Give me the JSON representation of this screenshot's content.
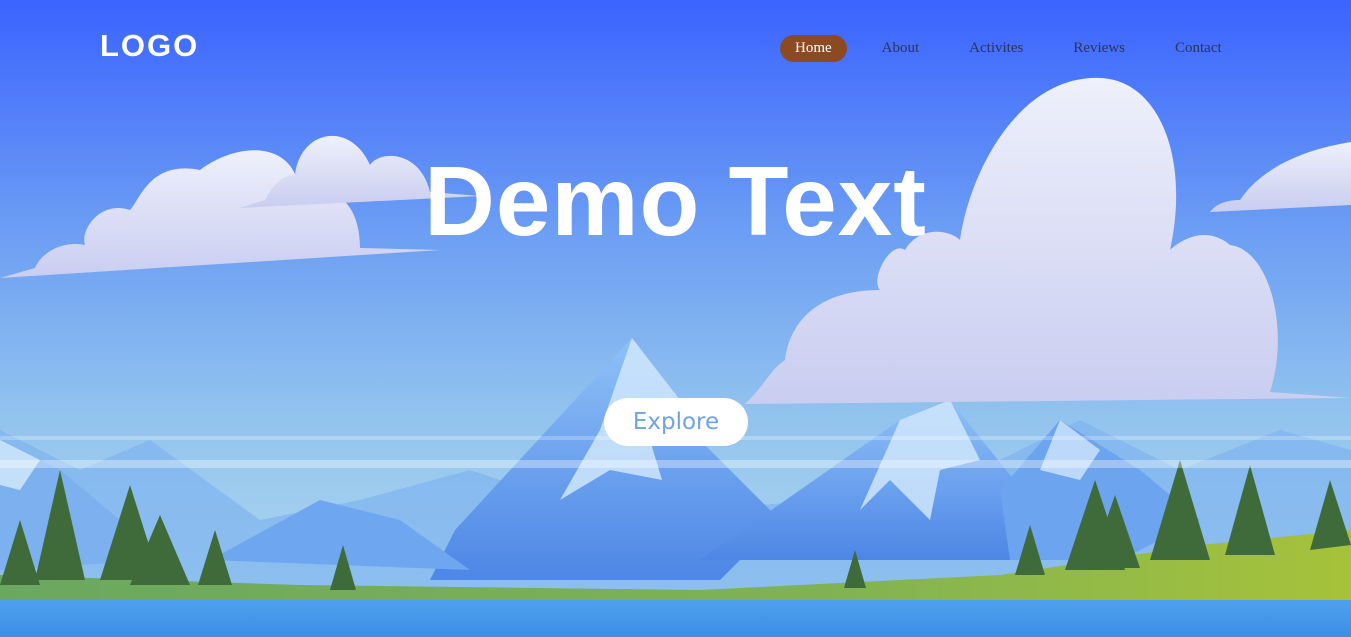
{
  "header": {
    "logo": "LOGO",
    "nav": [
      {
        "label": "Home",
        "active": true
      },
      {
        "label": "About",
        "active": false
      },
      {
        "label": "Activites",
        "active": false
      },
      {
        "label": "Reviews",
        "active": false
      },
      {
        "label": "Contact",
        "active": false
      }
    ]
  },
  "hero": {
    "title": "Demo Text",
    "button_label": "Explore"
  },
  "colors": {
    "sky_top": "#3b63ff",
    "sky_bottom": "#a8d6ec",
    "active_nav_bg": "#8b4a22",
    "button_text": "#6fa3e6"
  },
  "background": {
    "icons": [
      "cloud-icon",
      "mountain-icon",
      "pine-tree-icon"
    ]
  }
}
